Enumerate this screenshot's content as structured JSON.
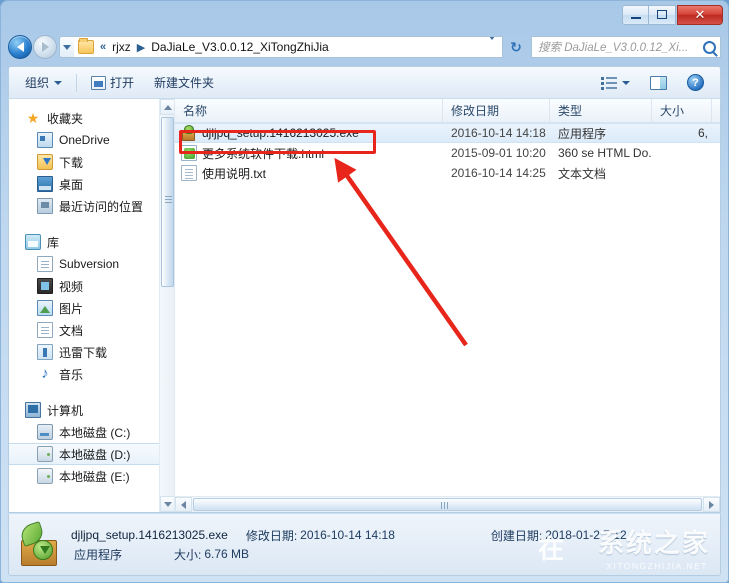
{
  "window": {
    "controls": {
      "minimize": "Minimize",
      "maximize": "Maximize",
      "close": "✕"
    }
  },
  "nav": {
    "back_label": "后退",
    "forward_label": "前进",
    "recent_label": "最近浏览的位置",
    "breadcrumbs": [
      {
        "label": "«",
        "type": "overflow"
      },
      {
        "label": "rjxz",
        "type": "crumb"
      },
      {
        "label": "DaJiaLe_V3.0.0.12_XiTongZhiJia",
        "type": "crumb"
      }
    ],
    "separator": "▶",
    "refresh_label": "刷新",
    "search_placeholder": "搜索 DaJiaLe_V3.0.0.12_Xi..."
  },
  "toolbar": {
    "organize": "组织",
    "open": "打开",
    "new_folder": "新建文件夹",
    "view_label": "更改您的视图",
    "preview_label": "显示预览窗格",
    "help_label": "获取帮助"
  },
  "sidebar": {
    "groups": [
      {
        "title": "收藏夹",
        "icon": "star-icon",
        "items": [
          {
            "label": "OneDrive",
            "icon": "onedrive-icon",
            "selected": false
          },
          {
            "label": "下载",
            "icon": "download-icon",
            "selected": false
          },
          {
            "label": "桌面",
            "icon": "desktop-icon",
            "selected": false
          },
          {
            "label": "最近访问的位置",
            "icon": "recent-places-icon",
            "selected": false
          }
        ]
      },
      {
        "title": "库",
        "icon": "library-icon",
        "items": [
          {
            "label": "Subversion",
            "icon": "document-icon",
            "selected": false
          },
          {
            "label": "视频",
            "icon": "video-icon",
            "selected": false
          },
          {
            "label": "图片",
            "icon": "picture-icon",
            "selected": false
          },
          {
            "label": "文档",
            "icon": "document-icon",
            "selected": false
          },
          {
            "label": "迅雷下载",
            "icon": "thunder-download-icon",
            "selected": false
          },
          {
            "label": "音乐",
            "icon": "music-icon",
            "selected": false
          }
        ]
      },
      {
        "title": "计算机",
        "icon": "computer-icon",
        "items": [
          {
            "label": "本地磁盘 (C:)",
            "icon": "drive-c-icon",
            "selected": false
          },
          {
            "label": "本地磁盘 (D:)",
            "icon": "drive-icon",
            "selected": true
          },
          {
            "label": "本地磁盘 (E:)",
            "icon": "drive-icon",
            "selected": false
          }
        ]
      }
    ]
  },
  "filelist": {
    "columns": [
      {
        "key": "name",
        "label": "名称"
      },
      {
        "key": "date",
        "label": "修改日期"
      },
      {
        "key": "type",
        "label": "类型"
      },
      {
        "key": "size",
        "label": "大小"
      }
    ],
    "sort_column": "名称",
    "rows": [
      {
        "name": "djljpq_setup.1416213025.exe",
        "date": "2016-10-14 14:18",
        "type": "应用程序",
        "size": "6,",
        "icon": "exe-installer-icon",
        "selected": true
      },
      {
        "name": "更多系统软件下载.html",
        "date": "2015-09-01 10:20",
        "type": "360 se HTML Do...",
        "size": "",
        "icon": "html-file-icon",
        "selected": false
      },
      {
        "name": "使用说明.txt",
        "date": "2016-10-14 14:25",
        "type": "文本文档",
        "size": "",
        "icon": "text-file-icon",
        "selected": false
      }
    ]
  },
  "details": {
    "filename": "djljpq_setup.1416213025.exe",
    "modified_label": "修改日期:",
    "modified_value": "2016-10-14 14:18",
    "created_label": "创建日期:",
    "created_value": "2018-01-2   7:12",
    "type_value": "应用程序",
    "size_label": "大小:",
    "size_value": "6.76 MB"
  },
  "watermark": {
    "chinese": "系统之家",
    "english": "XITONGZHIJIA.NET"
  },
  "annotation": {
    "box_target": "djljpq_setup.1416213025.exe",
    "color": "#e8251b"
  }
}
